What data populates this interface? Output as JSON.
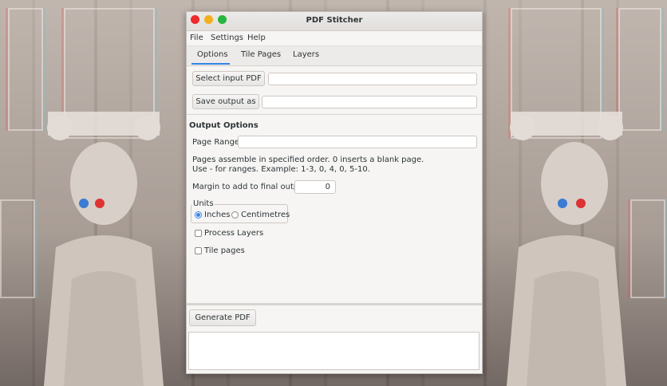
{
  "window": {
    "title": "PDF Stitcher"
  },
  "menu": {
    "items": [
      "File",
      "Settings",
      "Help"
    ]
  },
  "tabs": [
    {
      "label": "Options",
      "active": true
    },
    {
      "label": "Tile Pages",
      "active": false
    },
    {
      "label": "Layers",
      "active": false
    }
  ],
  "io": {
    "select_input_label": "Select input PDF",
    "input_value": "",
    "save_output_label": "Save output as",
    "output_value": ""
  },
  "output_options": {
    "heading": "Output Options",
    "page_range_label": "Page Range:",
    "page_range_value": "",
    "help_line1": "Pages assemble in specified order. 0 inserts a blank page.",
    "help_line2": "Use - for ranges. Example: 1-3, 0, 4, 0, 5-10.",
    "margin_label": "Margin to add to final output:",
    "margin_value": "0",
    "units_label": "Units",
    "unit_inches": "Inches",
    "unit_cm": "Centimetres",
    "selected_unit": "Inches",
    "process_layers_label": "Process Layers",
    "process_layers_checked": false,
    "tile_pages_label": "Tile pages",
    "tile_pages_checked": false
  },
  "actions": {
    "generate_label": "Generate PDF"
  },
  "colors": {
    "accent": "#3584e4",
    "close": "#ee2a2a",
    "minimize": "#f2b01e",
    "maximize": "#27b53f"
  }
}
